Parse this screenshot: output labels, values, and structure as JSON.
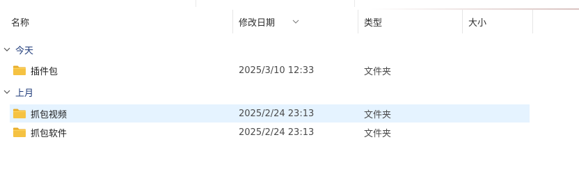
{
  "columns": {
    "name": "名称",
    "modified": "修改日期",
    "type": "类型",
    "size": "大小"
  },
  "groups": [
    {
      "label": "今天",
      "items": [
        {
          "name": "插件包",
          "modified": "2025/3/10 12:33",
          "type": "文件夹",
          "size": ""
        }
      ]
    },
    {
      "label": "上月",
      "items": [
        {
          "name": "抓包视频",
          "modified": "2025/2/24 23:13",
          "type": "文件夹",
          "size": "",
          "selected": true
        },
        {
          "name": "抓包软件",
          "modified": "2025/2/24 23:13",
          "type": "文件夹",
          "size": ""
        }
      ]
    }
  ],
  "icons": {
    "folder": "folder-icon",
    "chevron": "chevron-down-icon",
    "sort": "sort-descending-icon"
  },
  "colors": {
    "selection": "#e5f3ff",
    "group_label": "#1f3b7a",
    "folder_body": "#f5c242",
    "folder_tab": "#e8ad2a"
  }
}
